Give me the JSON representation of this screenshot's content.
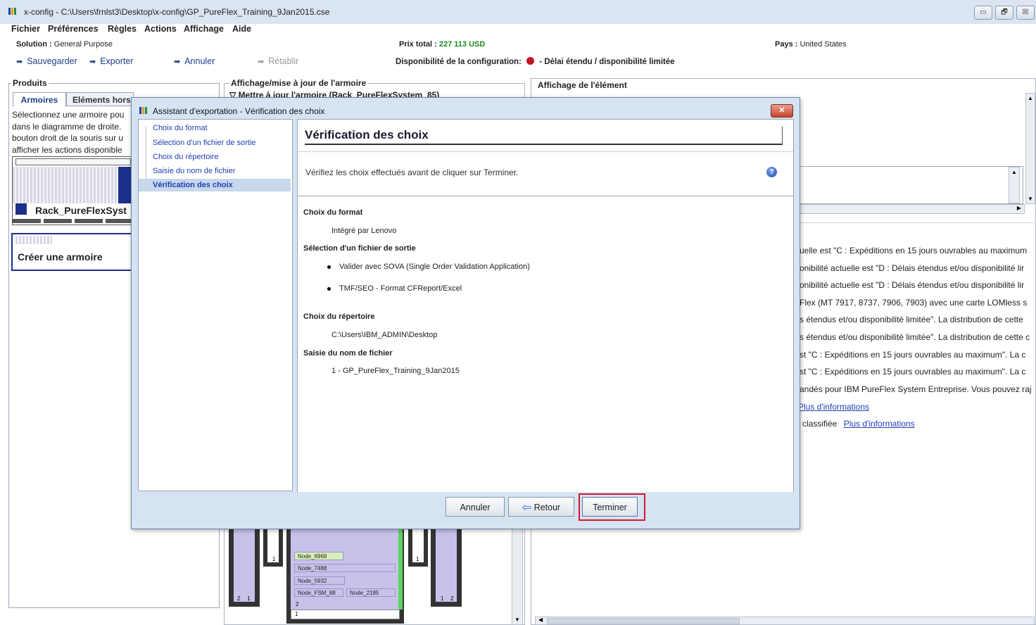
{
  "window": {
    "title": "x-config - C:\\Users\\frnlst3\\Desktop\\x-config\\GP_PureFlex_Training_9Jan2015.cse",
    "controls": [
      "▭",
      "🗗",
      "☒"
    ]
  },
  "menu": [
    "Fichier",
    "Préférences",
    "Règles",
    "Actions",
    "Affichage",
    "Aide"
  ],
  "info": {
    "solution_label": "Solution :",
    "solution_value": "General Purpose",
    "price_label": "Prix total :",
    "price_value": "227 113 USD",
    "country_label": "Pays :",
    "country_value": "United States",
    "availability_label": "Disponibilité de la configuration:",
    "availability_value": "- Délai étendu / disponibilité limitée",
    "availability_color": "#c0141e"
  },
  "toolbar": {
    "save": "Sauvegarder",
    "export": "Exporter",
    "cancel": "Annuler",
    "redo": "Rétablir"
  },
  "products": {
    "title": "Produits",
    "tab_active": "Armoires",
    "tab_other": "Eléments hors",
    "desc": [
      "Sélectionnez une armoire pou",
      "dans le diagramme de droite.",
      "bouton droit de la souris sur u",
      "afficher les actions disponible"
    ],
    "rack_name": "Rack_PureFlexSyst",
    "create_rack": "Créer une armoire"
  },
  "cabinet": {
    "title": "Affichage/mise à jour de l'armoire",
    "subtitle": "▽ Mettre à jour l'armoire (Rack_PureFlexSystem_85)",
    "nodes": [
      "Node_6968",
      "Node_7488",
      "Node_5932",
      "Node_FSM_88",
      "Node_2185"
    ],
    "slot_numbers": [
      "1",
      "1",
      "2",
      "1",
      "1",
      "2",
      "2",
      "1"
    ]
  },
  "element": {
    "title": "Affichage de l'élément",
    "messages": [
      "uelle est \"C : Expéditions en 15 jours ouvrables au maximum",
      "onibilité actuelle est \"D : Délais étendus et/ou disponibilité lir",
      "onibilité actuelle est \"D : Délais étendus et/ou disponibilité lir",
      "Flex (MT 7917, 8737, 7906, 7903) avec une carte LOMless s",
      "s étendus et/ou disponibilité limitée\". La distribution de cette",
      "s étendus et/ou disponibilité limitée\". La distribution de cette c",
      "st \"C : Expéditions en 15 jours ouvrables au maximum\". La c",
      "st \"C : Expéditions en 15 jours ouvrables au maximum\". La c",
      "andés pour IBM PureFlex System Entreprise. Vous pouvez raj"
    ],
    "more_info_1": "Plus d'informations",
    "classified_prefix": "classifiée",
    "more_info_2": "Plus d'informations"
  },
  "dialog": {
    "title": "Assistant d'exportation - Vérification des choix",
    "close": "✕",
    "steps": [
      "Choix du format",
      "Sélection d'un fichier de sortie",
      "Choix du répertoire",
      "Saisie du nom de fichier",
      "Vérification des choix"
    ],
    "header": "Vérification des choix",
    "instruction": "Vérifiez les choix effectués avant de cliquer sur Terminer.",
    "help": "?",
    "sections": {
      "format_title": "Choix du format",
      "format_value": "Intégré par Lenovo",
      "output_title": "Sélection d'un fichier de sortie",
      "output_items": [
        "Valider avec SOVA (Single Order Validation Application)",
        "TMF/SEO - Format CFReport/Excel"
      ],
      "dir_title": "Choix du répertoire",
      "dir_value": "C:\\Users\\IBM_ADMIN\\Desktop",
      "filename_title": "Saisie du nom de fichier",
      "filename_value": "1 - GP_PureFlex_Training_9Jan2015"
    },
    "buttons": {
      "cancel": "Annuler",
      "back": "Retour",
      "finish": "Terminer"
    }
  }
}
